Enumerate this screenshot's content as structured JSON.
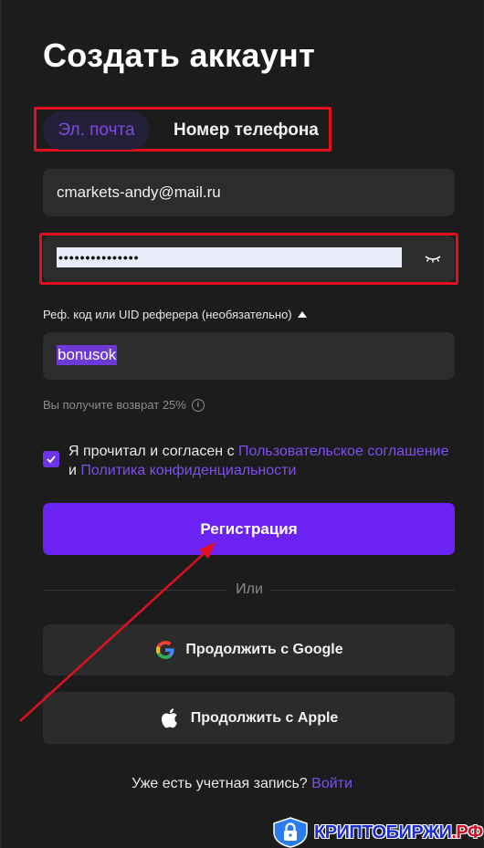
{
  "page": {
    "title": "Создать аккаунт"
  },
  "tabs": {
    "email_label": "Эл. почта",
    "phone_label": "Номер телефона",
    "active": "email"
  },
  "form": {
    "email_value": "cmarkets-andy@mail.ru",
    "password_value": "•••••••••••••••",
    "referral_label": "Реф. код или UID реферера (необязательно)",
    "referral_value": "bonusok",
    "cashback_text": "Вы получите возврат 25%",
    "agree_checked": true,
    "agree_prefix": "Я прочитал и согласен с",
    "agree_link_terms": "Пользовательское соглашение",
    "agree_and": "и",
    "agree_link_privacy": "Политика конфиденциальности"
  },
  "actions": {
    "register_label": "Регистрация",
    "or_label": "Или",
    "google_label": "Продолжить с Google",
    "apple_label": "Продолжить с Apple"
  },
  "footer": {
    "have_account": "Уже есть учетная запись?",
    "login_link": "Войти"
  },
  "watermark": {
    "text": "КРИПТОБИРЖИ",
    "suffix": ".РФ"
  },
  "colors": {
    "accent": "#6c22f2",
    "link": "#7c4ff0",
    "highlight_box": "#e0101e",
    "background": "#1c1c1d",
    "field": "#2c2c2d"
  }
}
